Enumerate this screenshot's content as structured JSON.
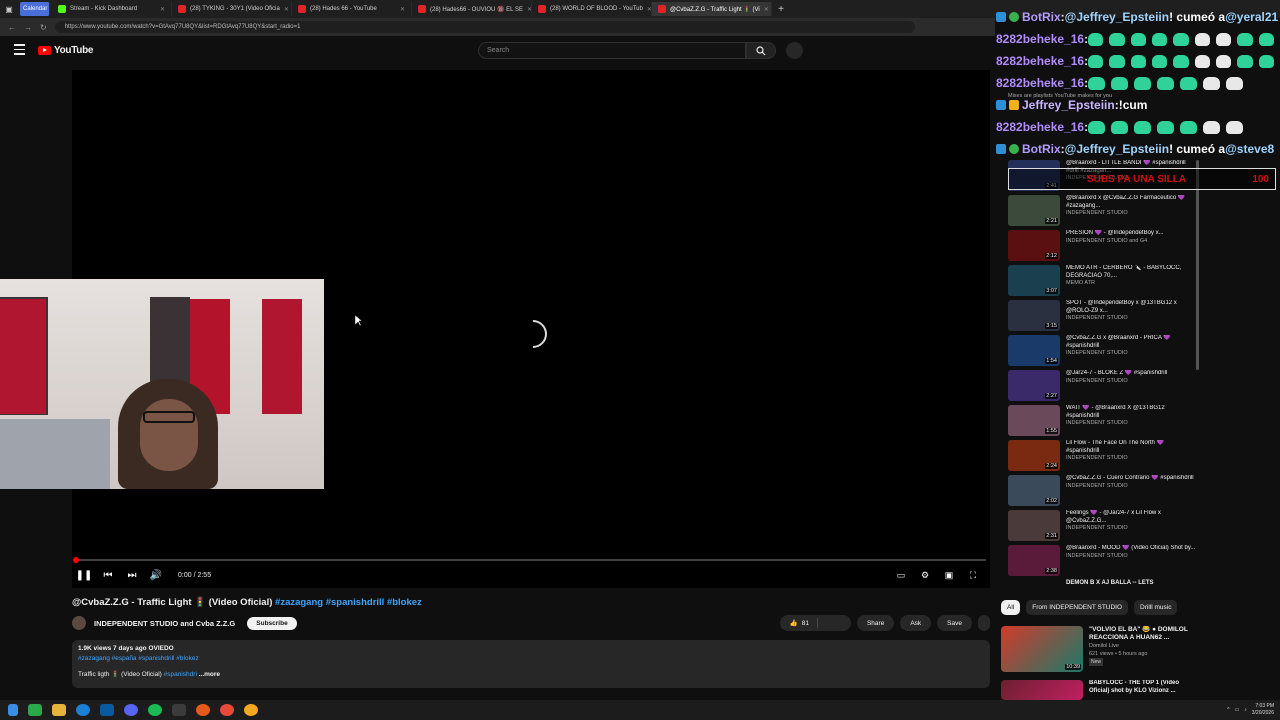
{
  "browser": {
    "tabs": [
      {
        "label": "Calendar",
        "icon": "calendar-icon"
      },
      {
        "label": "Stream - Kick Dashboard",
        "icon": "kick-icon"
      },
      {
        "label": "(28) TYKING - 30Y1 (Video Oficia",
        "icon": "youtube-icon"
      },
      {
        "label": "(28) Hades 66 - YouTube",
        "icon": "youtube-icon"
      },
      {
        "label": "(28) Hades66 - OUVIOU 🔞 EL SE",
        "icon": "youtube-icon"
      },
      {
        "label": "(28) WORLD OF BLOOD - YouTub",
        "icon": "youtube-icon"
      },
      {
        "label": "@CvbaZ.Z.G - Traffic Light 🚦 (Vi",
        "icon": "youtube-icon"
      }
    ],
    "url": "https://www.youtube.com/watch?v=GtAvq77U8QY&list=RDGtAvq77U8QY&start_radio=1"
  },
  "youtube": {
    "logo": "YouTube",
    "search_placeholder": "Search"
  },
  "player": {
    "time": "0:00 / 2:55",
    "progress_fraction": 0.0
  },
  "video": {
    "title": "@CvbaZ.Z.G - Traffic Light 🚦 (Video Oficial)",
    "title_tags": "#zazagang #spanishdrill #blokez",
    "channel": "INDEPENDENT STUDIO and Cvba Z.Z.G",
    "subscribe": "Subscribe",
    "likes": "81",
    "share": "Share",
    "ask": "Ask",
    "save": "Save",
    "meta": "1.9K views  7 days ago  OVIEDO",
    "desc_tags": "#zazagang #españa #spanishdrill #blokez",
    "desc_line": "Traffic ligth 🚦 (Video Oficial)",
    "desc_line_tag": "#spanishdri",
    "more": "...more"
  },
  "recommendations": [
    {
      "title": "@Braanxrd - LITTLE BANDI 💜 #spanishdrill #drill #zazagan...",
      "channel": "INDEPENDENT STUDIO",
      "duration": "2:41",
      "color": "#23305a"
    },
    {
      "title": "@Braanxrd x @CvbaZ.Z.G Farmaceutico 💜 #zazagang...",
      "channel": "INDEPENDENT STUDIO",
      "duration": "2:21",
      "color": "#3b4a3a"
    },
    {
      "title": "PRESION 💜 - @IndependetBoy x...",
      "channel": "INDEPENDENT STUDIO and G4",
      "duration": "2:12",
      "color": "#5a1010"
    },
    {
      "title": "MEMO ATR - CERBERO 🔪 - BABYLOCC, DEGRACIAO 70,...",
      "channel": "MEMO ATR",
      "duration": "3:07",
      "color": "#1a4050"
    },
    {
      "title": "SPOT - @IndependetBoy x @13TBG12 x @ROLO-Z9 x...",
      "channel": "INDEPENDENT STUDIO",
      "duration": "3:15",
      "color": "#2a3040"
    },
    {
      "title": "@CvbaZ.Z.G x @Braanxrd - PRICA 💜 #spanishdrill",
      "channel": "INDEPENDENT STUDIO",
      "duration": "1:54",
      "color": "#1a3a6a"
    },
    {
      "title": "@Jar24-7 - BLOKE Z 💜 #spanishdrill",
      "channel": "INDEPENDENT STUDIO",
      "duration": "2:27",
      "color": "#3a2a6a"
    },
    {
      "title": "WAIT 💜 - @Braanxrd X @13TBG12 #spanishdrill",
      "channel": "INDEPENDENT STUDIO",
      "duration": "1:55",
      "color": "#6a4a5a"
    },
    {
      "title": "Lil Flow - The Face On The North 💜 #spanishdrill",
      "channel": "INDEPENDENT STUDIO",
      "duration": "2:24",
      "color": "#7a2a10"
    },
    {
      "title": "@CvbaZ.Z.G - Cuero Contrario 💜 #spanishdrill",
      "channel": "INDEPENDENT STUDIO",
      "duration": "2:02",
      "color": "#3a4a5a"
    },
    {
      "title": "Feelings 💜 - @Jar24-7 x Lil Flow x @CvbaZ.Z.G...",
      "channel": "INDEPENDENT STUDIO",
      "duration": "2:31",
      "color": "#4a3a3a"
    },
    {
      "title": "@Braanxrd - MOOD 💜 (Video Oficial) Shot by...",
      "channel": "INDEPENDENT STUDIO",
      "duration": "2:38",
      "color": "#5a1a3a"
    }
  ],
  "rec_cut": "DEMON B X AJ BALLA -- LETS",
  "filters": [
    "All",
    "From INDEPENDENT STUDIO",
    "Drilll music"
  ],
  "big_rec": {
    "title": "\"VOLVIO EL BA\" 😂 ● DOMILOL REACCIONA A HUAN62 ...",
    "channel": "Domilol Live",
    "meta": "621 views • 5 hours ago",
    "badge": "New",
    "duration": "10:39"
  },
  "big_rec2": {
    "title": "BABYLOCC - THE TOP 1 (Video Oficial) shot by KLO Vizionz ..."
  },
  "chat": [
    {
      "icons": [
        "b",
        "g"
      ],
      "user": "BotRix",
      "sep": ": ",
      "mention": "@Jeffrey_Epsteiin",
      "text": "! cumeó a ",
      "mention2": "@yeral21",
      "ucls": "u1"
    },
    {
      "icons": [],
      "user": "8282beheke_16",
      "sep": " : ",
      "emotes": 9,
      "ucls": "u2"
    },
    {
      "icons": [],
      "user": "8282beheke_16",
      "sep": " : ",
      "emotes": 9,
      "ucls": "u2"
    },
    {
      "icons": [],
      "user": "8282beheke_16",
      "sep": " : ",
      "emotes": 7,
      "ucls": "u2"
    },
    {
      "icons": [
        "b",
        "y"
      ],
      "user": "Jeffrey_Epsteiin",
      "sep": " : ",
      "text": "!cum",
      "ucls": "u3"
    },
    {
      "icons": [],
      "user": "8282beheke_16",
      "sep": " : ",
      "emotes": 7,
      "ucls": "u2"
    },
    {
      "icons": [
        "b",
        "g"
      ],
      "user": "BotRix",
      "sep": ": ",
      "mention": "@Jeffrey_Epsteiin",
      "text": "! cumeó a ",
      "mention2": "@steve8",
      "ucls": "u1"
    }
  ],
  "chat_caption": "Mixes are playlists YouTube makes for you",
  "silla": {
    "label": "SUBS PA UNA SILLA",
    "value": "100"
  },
  "taskbar": {
    "time": "7:03 PM",
    "date": "3/20/2026"
  },
  "colors": {
    "accent_red": "#ff0000",
    "link_blue": "#3ea6ff",
    "chat_green_emote": "#2fd39a"
  }
}
